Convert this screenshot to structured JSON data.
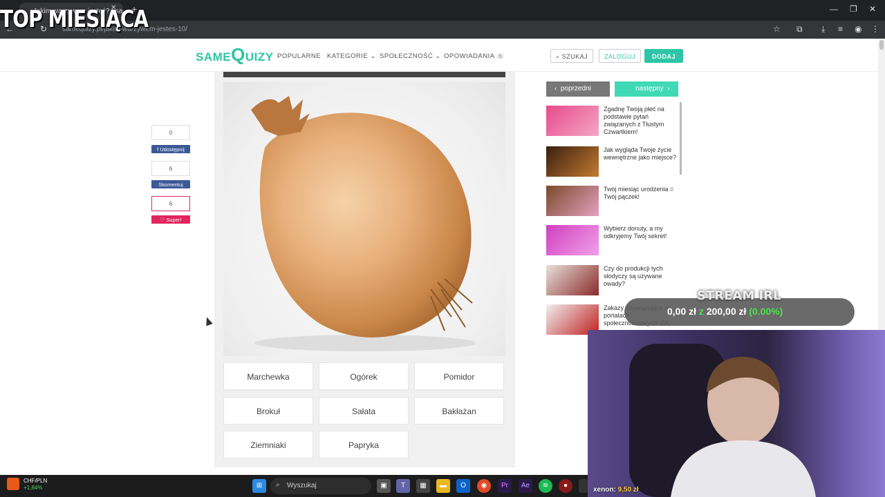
{
  "browser": {
    "tab_title": "Jakim warzywem jesteś? | sam…",
    "url": "samequizy.pl/jakim-warzywem-jestes-10/"
  },
  "stream_overlay": {
    "title": "TOP MIESIĄCA",
    "label": "STREAM IRL",
    "goal_current": "0,00 zł",
    "goal_sep": "z",
    "goal_target": "200,00 zł",
    "goal_percent": "(0.00%)",
    "donor": "xenon:",
    "donation": "9,50 zł"
  },
  "header": {
    "logo_a": "SAME",
    "logo_q": "Q",
    "logo_b": "UIZY",
    "nav": [
      "POPULARNE",
      "KATEGORIE ⌄",
      "SPOŁECZNOŚĆ ⌄",
      "OPOWIADANIA"
    ],
    "stories_count": "6",
    "search": "SZUKAJ",
    "login": "ZALOGUJ",
    "add": "DODAJ"
  },
  "share": {
    "fb_count": "0",
    "fb_label": "Udostępnij",
    "comment_count": "6",
    "comment_label": "Skomentuj",
    "super_count": "6",
    "super_label": "Super!"
  },
  "quiz": {
    "answers": [
      "Marchewka",
      "Ogórek",
      "Pomidor",
      "Brokuł",
      "Sałata",
      "Bakłażan",
      "Ziemniaki",
      "Papryka"
    ]
  },
  "sidebar": {
    "prev": "poprzedni",
    "next": "następny",
    "items": [
      "Zgadnę Twoją płeć na podstawie pytań związanych z Tłustym Czwartkiem!",
      "Jak wygląda Twoje życie wewnętrzne jako miejsce?",
      "Twój miesiąc urodzenia = Twój pączek!",
      "Wybierz donuty, a my odkryjemy Twój sekret!",
      "Czy do produkcji tych słodyczy są używane owady?",
      "Zakazy obowiązujące na portalach społecznościowych! ZA..."
    ]
  },
  "taskbar": {
    "ticker_pair": "CHF/PLN",
    "ticker_change": "+1,84%",
    "search": "Wyszukaj"
  },
  "colors": {
    "brand": "#2ec5a6",
    "facebook": "#3b5998",
    "super": "#e0245e",
    "goal_green": "#4be34b"
  }
}
